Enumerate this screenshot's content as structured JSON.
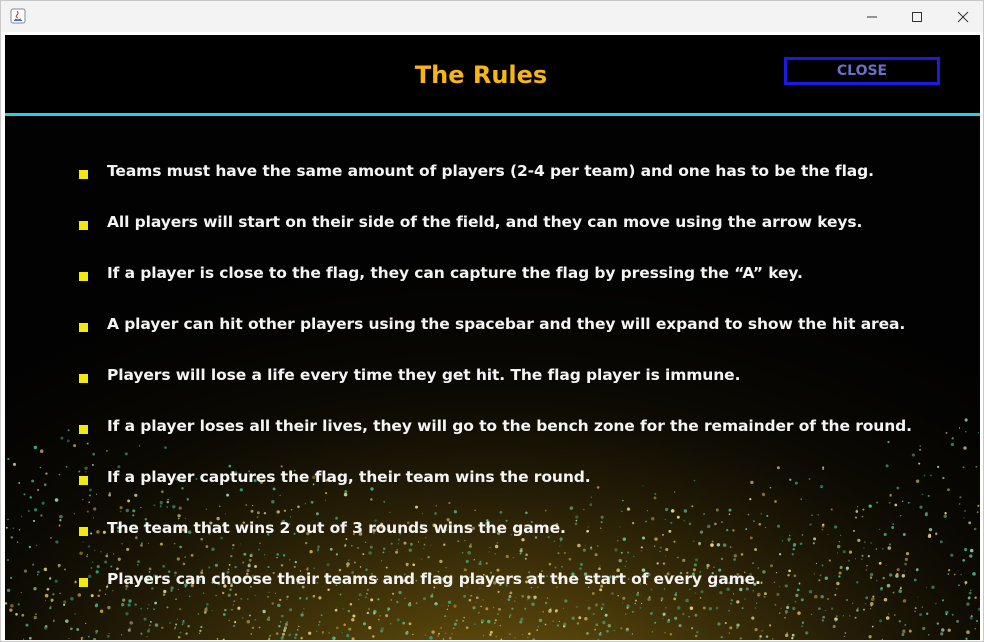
{
  "window": {
    "controls": {
      "minimize": "—",
      "maximize": "☐",
      "close": "✕"
    }
  },
  "header": {
    "title": "The Rules",
    "close_label": "CLOSE"
  },
  "rules": [
    "Teams must have the same amount of players (2-4 per team) and one has to be the flag.",
    "All players will start on their side of the field, and they can move using the arrow keys.",
    "If a player is close to the flag, they can capture the flag by pressing the “A” key.",
    "A player can hit other players using the spacebar and they will expand to show the hit area.",
    "Players will lose a life every time they get hit. The flag player is immune.",
    "If a player loses all their lives, they will go to the bench zone for the remainder of the round.",
    "If a player captures the flag, their team wins the round.",
    "The team that wins 2 out of 3 rounds wins the game.",
    "Players can choose their teams and flag players at the start of every game."
  ],
  "colors": {
    "title": "#f7b516",
    "accent_line": "#1fd4dc",
    "close_border": "#1a1ae0",
    "close_text": "#6a70c8",
    "bullet": "#f2ea0c",
    "rule_text": "#f4f4f4",
    "background": "#020202"
  }
}
